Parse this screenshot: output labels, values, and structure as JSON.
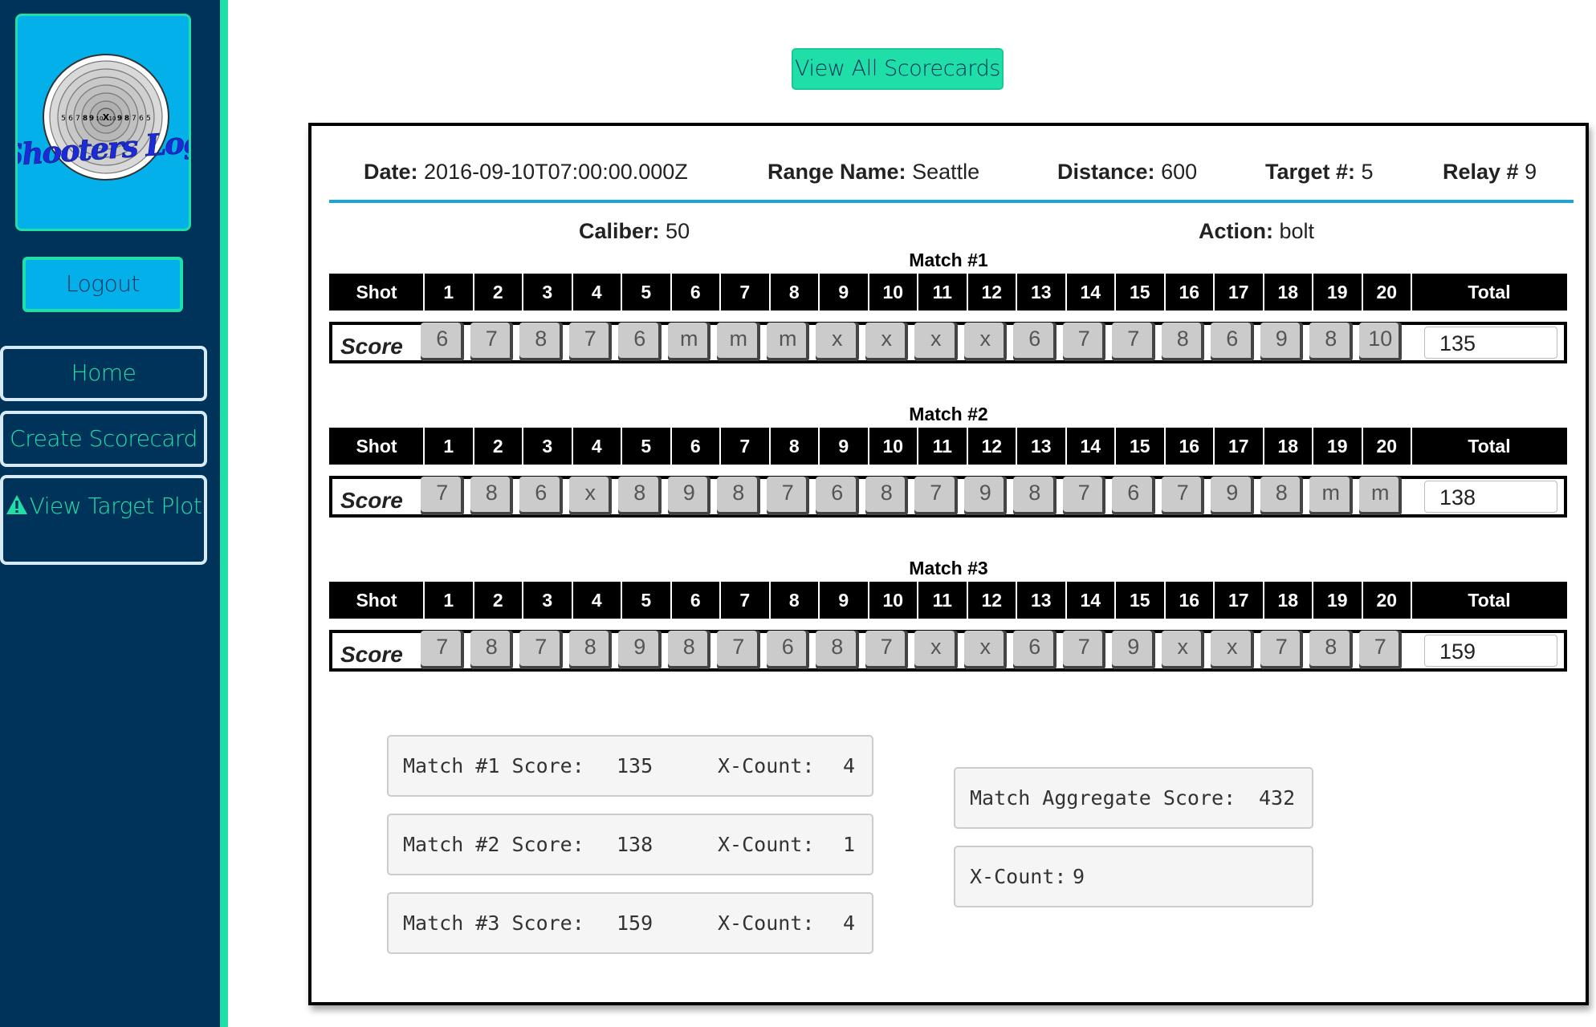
{
  "sidebar": {
    "logo_text": "Shooters Log",
    "logo_rings": [
      "5",
      "6",
      "7",
      "8",
      "9",
      "10",
      "X",
      "10",
      "9",
      "8",
      "7",
      "6",
      "5"
    ],
    "logout_label": "Logout",
    "nav": [
      {
        "label": "Home"
      },
      {
        "label": "Create Scorecard"
      },
      {
        "label": "View Target Plot",
        "icon": "warning-icon"
      }
    ]
  },
  "top": {
    "view_all_label": "View All Scorecards"
  },
  "scorecard": {
    "date_label": "Date:",
    "date_value": "2016-09-10T07:00:00.000Z",
    "range_label": "Range Name:",
    "range_value": "Seattle",
    "distance_label": "Distance:",
    "distance_value": "600",
    "target_label": "Target #:",
    "target_value": "5",
    "relay_label": "Relay #",
    "relay_value": "9",
    "caliber_label": "Caliber:",
    "caliber_value": "50",
    "action_label": "Action:",
    "action_value": "bolt",
    "header_labels": {
      "shot": "Shot",
      "total": "Total",
      "score": "Score"
    },
    "shot_numbers": [
      "1",
      "2",
      "3",
      "4",
      "5",
      "6",
      "7",
      "8",
      "9",
      "10",
      "11",
      "12",
      "13",
      "14",
      "15",
      "16",
      "17",
      "18",
      "19",
      "20"
    ],
    "matches": [
      {
        "title": "Match #1",
        "shots": [
          "6",
          "7",
          "8",
          "7",
          "6",
          "m",
          "m",
          "m",
          "x",
          "x",
          "x",
          "x",
          "6",
          "7",
          "7",
          "8",
          "6",
          "9",
          "8",
          "10"
        ],
        "total": "135"
      },
      {
        "title": "Match #2",
        "shots": [
          "7",
          "8",
          "6",
          "x",
          "8",
          "9",
          "8",
          "7",
          "6",
          "8",
          "7",
          "9",
          "8",
          "7",
          "6",
          "7",
          "9",
          "8",
          "m",
          "m"
        ],
        "total": "138"
      },
      {
        "title": "Match #3",
        "shots": [
          "7",
          "8",
          "7",
          "8",
          "9",
          "8",
          "7",
          "6",
          "8",
          "7",
          "x",
          "x",
          "6",
          "7",
          "9",
          "x",
          "x",
          "7",
          "8",
          "7"
        ],
        "total": "159"
      }
    ]
  },
  "summary": {
    "matches": [
      {
        "label": "Match #1 Score:",
        "score": "135",
        "xcount_label": "X-Count:",
        "xcount": "4"
      },
      {
        "label": "Match #2 Score:",
        "score": "138",
        "xcount_label": "X-Count:",
        "xcount": "1"
      },
      {
        "label": "Match #3 Score:",
        "score": "159",
        "xcount_label": "X-Count:",
        "xcount": "4"
      }
    ],
    "aggregate_label": "Match Aggregate Score:",
    "aggregate_value": "432",
    "total_x_label": "X-Count:",
    "total_x_value": "9"
  },
  "colors": {
    "sidebar_bg": "#003359",
    "accent": "#1fdea7",
    "logo_bg": "#03b0ea",
    "header_line": "#1ba3dc"
  }
}
